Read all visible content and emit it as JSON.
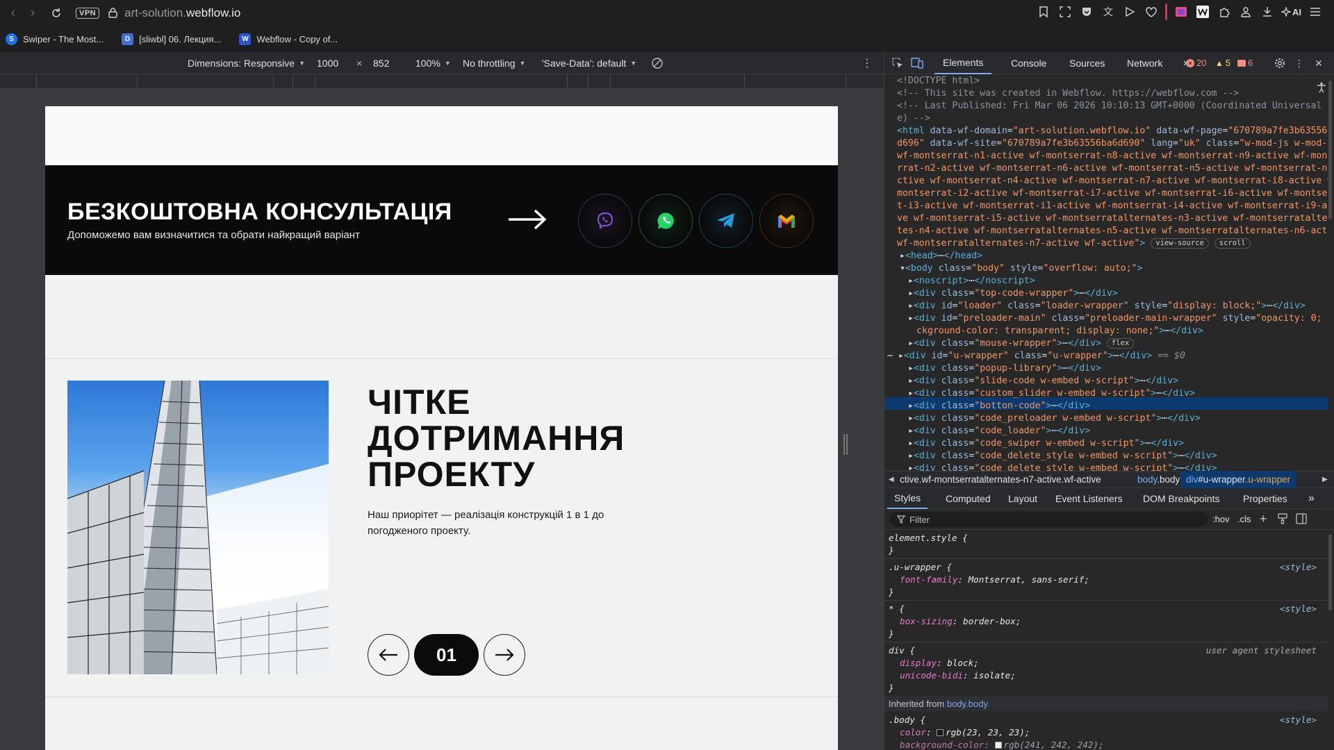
{
  "browser": {
    "vpn_label": "VPN",
    "url_prefix": "art-solution.",
    "url_host": "webflow.io",
    "ai_label": "AI",
    "bookmarks": [
      {
        "label": "Swiper - The Most...",
        "icon_color": "#1a73e8",
        "icon_text": "S"
      },
      {
        "label": "[sliwbl] 06. Лекция...",
        "icon_color": "#3d6fe0",
        "icon_text": "D"
      },
      {
        "label": "Webflow - Copy of...",
        "icon_color": "#2a56d4",
        "icon_text": "W"
      }
    ]
  },
  "device_toolbar": {
    "dimensions_label": "Dimensions: Responsive",
    "width": "1000",
    "times": "×",
    "height": "852",
    "zoom": "100%",
    "throttling": "No throttling",
    "save_data": "'Save-Data': default"
  },
  "site": {
    "cta_title": "БЕЗКОШТОВНА КОНСУЛЬТАЦІЯ",
    "cta_subtitle": "Допоможемо вам визначитися та обрати найкращий варіант",
    "social": [
      {
        "name": "viber",
        "color": "#7d53c8"
      },
      {
        "name": "whatsapp",
        "color": "#25d366"
      },
      {
        "name": "telegram",
        "color": "#229ed9"
      },
      {
        "name": "gmail",
        "color": "#ea4335"
      }
    ],
    "slide": {
      "title_line1": "ЧІТКЕ",
      "title_line2": "ДОТРИМАННЯ",
      "title_line3": "ПРОЕКТУ",
      "description": "Наш приорітет — реалізація конструкцій 1 в 1 до погодженого проекту.",
      "number": "01"
    }
  },
  "devtools": {
    "tabs": [
      "Elements",
      "Console",
      "Sources",
      "Network"
    ],
    "more": "»",
    "errors": "20",
    "warnings": "5",
    "issues": "6",
    "dom": {
      "l1": "<!DOCTYPE html>",
      "l2": "<!-- This site was created in Webflow. https://webflow.com -->",
      "l3": "<!-- Last Published: Fri Mar 06 2026 10:10:13 GMT+0000 (Coordinated Universal Tim",
      "l4": "e) -->",
      "html_tag": "<html ",
      "html_a1": "data-wf-domain",
      "html_v1": "\"art-solution.webflow.io\"",
      "html_a2": "data-wf-page",
      "html_v2a": "\"670789a7fe3b63556ba6",
      "html_v2b": "d696\"",
      "html_a3": "data-wf-site",
      "html_v3": "\"670789a7fe3b63556ba6d690\"",
      "html_a4": "lang",
      "html_v4": "\"uk\"",
      "html_a5": "class",
      "html_v5a": "\"w-mod-js w-mod-ix",
      "cls2": "wf-montserrat-n1-active wf-montserrat-n8-active wf-montserrat-n9-active wf-montse",
      "cls3": "rrat-n2-active wf-montserrat-n6-active wf-montserrat-n5-active wf-montserrat-n3-a",
      "cls4": "ctive wf-montserrat-n4-active wf-montserrat-n7-active wf-montserrat-i8-active wf-",
      "cls5": "montserrat-i2-active wf-montserrat-i7-active wf-montserrat-i6-active wf-montserra",
      "cls6": "t-i3-active wf-montserrat-i1-active wf-montserrat-i4-active wf-montserrat-i9-acti",
      "cls7": "ve wf-montserrat-i5-active wf-montserratalternates-n3-active wf-montserratalterna",
      "cls8": "tes-n4-active wf-montserratalternates-n5-active wf-montserratalternates-n6-active",
      "cls9": "wf-montserratalternates-n7-active wf-active\"",
      "view_source": "view-source",
      "scroll": "scroll",
      "head": "<head>",
      "head_close": "</head>",
      "body_open": "<body ",
      "body_class": "\"body\"",
      "body_style": "\"overflow: auto;\"",
      "ellipsis": "⋯",
      "noscript": "<noscript>",
      "noscript_close": "</noscript>",
      "div_open": "<div ",
      "div_close": "</div>",
      "cls_top": "\"top-code-wrapper\"",
      "id_loader": "\"loader\"",
      "cls_loader": "\"loader-wrapper\"",
      "style_loader": "\"display: block;\"",
      "id_pre": "\"preloader-main\"",
      "cls_pre": "\"preloader-main-wrapper\"",
      "style_pre_a": "\"opacity: 0; ba",
      "style_pre_b": "ckground-color: transparent; display: none;\"",
      "cls_mouse": "\"mouse-wrapper\"",
      "flex": "flex",
      "id_u": "\"u-wrapper\"",
      "cls_u": "\"u-wrapper\"",
      "sel_marker": " == $0",
      "cls_popup": "\"popup-library\"",
      "cls_slide": "\"slide-code w-embed w-script\"",
      "cls_custom": "\"custom_slider w-embed w-script\"",
      "cls_botton": "\"botton-code\"",
      "cls_cpre": "\"code_preloader w-embed w-script\"",
      "cls_cload": "\"code_loader\"",
      "cls_cswiper": "\"code_swiper w-embed w-script\"",
      "cls_cdel": "\"code_delete_style w-embed w-script\""
    },
    "breadcrumbs": {
      "c1": "ctive.wf-montserratalternates-n7-active.wf-active",
      "c2a": "body",
      "c2b": ".body",
      "c3a": "div",
      "c3b": "#u-wrapper",
      "c3c": ".u-wrapper"
    },
    "sub_tabs": [
      "Styles",
      "Computed",
      "Layout",
      "Event Listeners",
      "DOM Breakpoints",
      "Properties"
    ],
    "filter_placeholder": "Filter",
    "hov": ":hov",
    "cls": ".cls",
    "styles": {
      "s1": "element.style {",
      "close": "}",
      "s2": ".u-wrapper {",
      "s2p": "font-family",
      "s2v": "Montserrat, sans-serif;",
      "src_style": "<style>",
      "s3": "* {",
      "s3p": "box-sizing",
      "s3v": "border-box;",
      "s4": "div {",
      "ua": "user agent stylesheet",
      "s4p1": "display",
      "s4v1": "block;",
      "s4p2": "unicode-bidi",
      "s4v2": "isolate;",
      "inherited": "Inherited from ",
      "inherited_link": "body.body",
      "s5": ".body {",
      "s5p1": "color",
      "s5v1": "rgb(23, 23, 23);",
      "s5p2": "background-color",
      "s5v2": "rgb(241, 242, 242);"
    }
  }
}
